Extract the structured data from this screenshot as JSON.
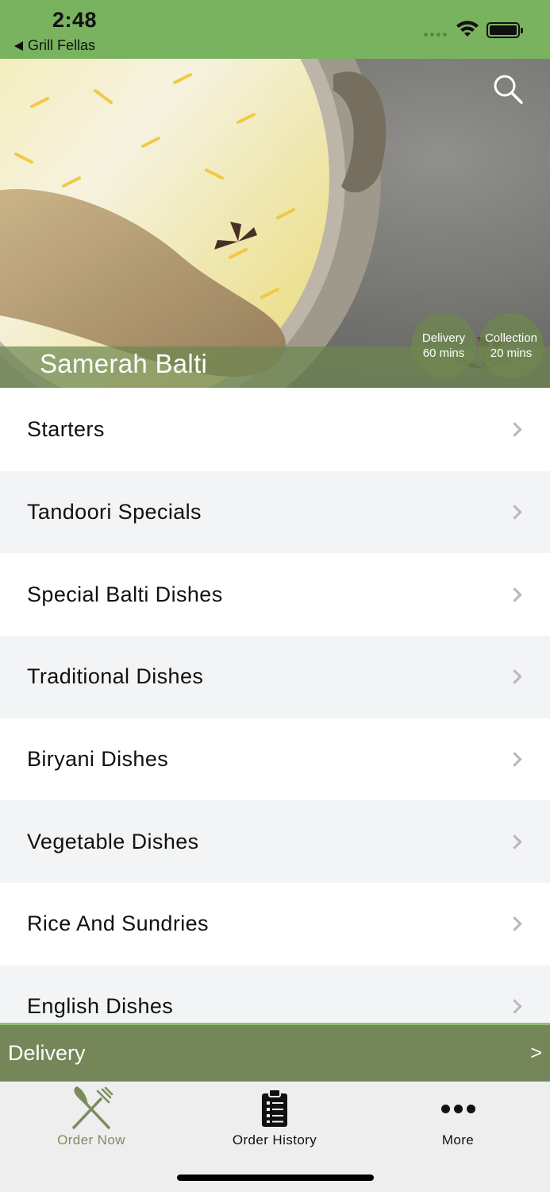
{
  "status_bar": {
    "time": "2:48",
    "back_app": "Grill Fellas",
    "color": "#7ab35f"
  },
  "hero": {
    "restaurant_name": "Samerah Balti",
    "search_icon": "search-icon",
    "delivery": {
      "label": "Delivery",
      "time": "60 mins"
    },
    "collection": {
      "label": "Collection",
      "time": "20 mins"
    }
  },
  "menu": {
    "items": [
      {
        "label": "Starters"
      },
      {
        "label": "Tandoori Specials"
      },
      {
        "label": "Special Balti Dishes"
      },
      {
        "label": "Traditional Dishes"
      },
      {
        "label": "Biryani Dishes"
      },
      {
        "label": "Vegetable Dishes"
      },
      {
        "label": "Rice And Sundries"
      },
      {
        "label": "English Dishes"
      }
    ]
  },
  "delivery_bar": {
    "label": "Delivery",
    "arrow": ">",
    "color": "#758659"
  },
  "tab_bar": {
    "tabs": [
      {
        "label": "Order Now",
        "icon": "fork-knife-icon",
        "active": true
      },
      {
        "label": "Order History",
        "icon": "clipboard-list-icon",
        "active": false
      },
      {
        "label": "More",
        "icon": "more-dots-icon",
        "active": false
      }
    ]
  }
}
